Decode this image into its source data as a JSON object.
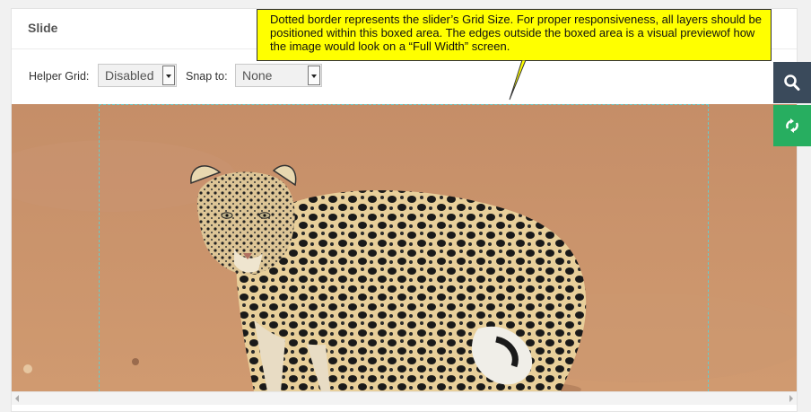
{
  "panel": {
    "title": "Slide"
  },
  "toolbar": {
    "helper_grid_label": "Helper Grid:",
    "helper_grid_value": "Disabled",
    "snap_to_label": "Snap to:",
    "snap_to_value": "None"
  },
  "callout": {
    "text": "Dotted border represents the slider’s Grid Size.  For proper responsiveness, all layers should be positioned within this boxed area.  The edges outside the boxed area is a visual previewof how the image would look on a “Full Width” screen."
  },
  "side_buttons": [
    {
      "icon": "search-icon"
    },
    {
      "icon": "sync-icon"
    }
  ],
  "colors": {
    "callout_bg": "#ffff00",
    "grid_border": "#66cccc",
    "search_button_bg": "#3a4a5b",
    "sync_button_bg": "#27ae60",
    "ground": "#c88f66"
  }
}
